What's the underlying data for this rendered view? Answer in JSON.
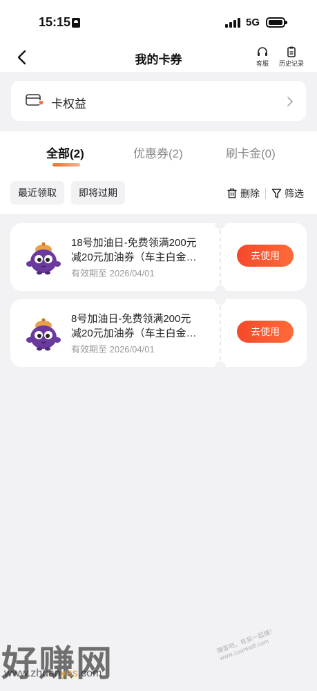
{
  "status_bar": {
    "time": "15:15",
    "network": "5G"
  },
  "nav": {
    "title": "我的卡券",
    "service_label": "客服",
    "history_label": "历史记录"
  },
  "benefit": {
    "label": "卡权益"
  },
  "tabs": [
    {
      "label": "全部(2)",
      "active": true
    },
    {
      "label": "优惠券(2)",
      "active": false
    },
    {
      "label": "刷卡金(0)",
      "active": false
    }
  ],
  "filters": {
    "recent_label": "最近领取",
    "expiring_label": "即将过期",
    "delete_label": "删除",
    "filter_label": "筛选"
  },
  "coupons": [
    {
      "title_line1": "18号加油日-免费领满200元",
      "title_line2": "减20元加油券（车主白金…",
      "expiry": "有效期至 2026/04/01",
      "button": "去使用"
    },
    {
      "title_line1": "8号加油日-免费领满200元",
      "title_line2": "减20元加油券（车主白金…",
      "expiry": "有效期至 2026/04/01",
      "button": "去使用"
    }
  ],
  "watermark": {
    "brand": "好赚网",
    "url_part1": "www.zhuan",
    "url_part2": "yes",
    "url_part3": ".com",
    "slogan": "赚客吧，有奖一起赚！www.zuanke8.com"
  },
  "colors": {
    "accent": "#f4492a",
    "background": "#f2f2f5",
    "mascot_body": "#6b3a9e",
    "mascot_hat": "#e8a04a"
  }
}
